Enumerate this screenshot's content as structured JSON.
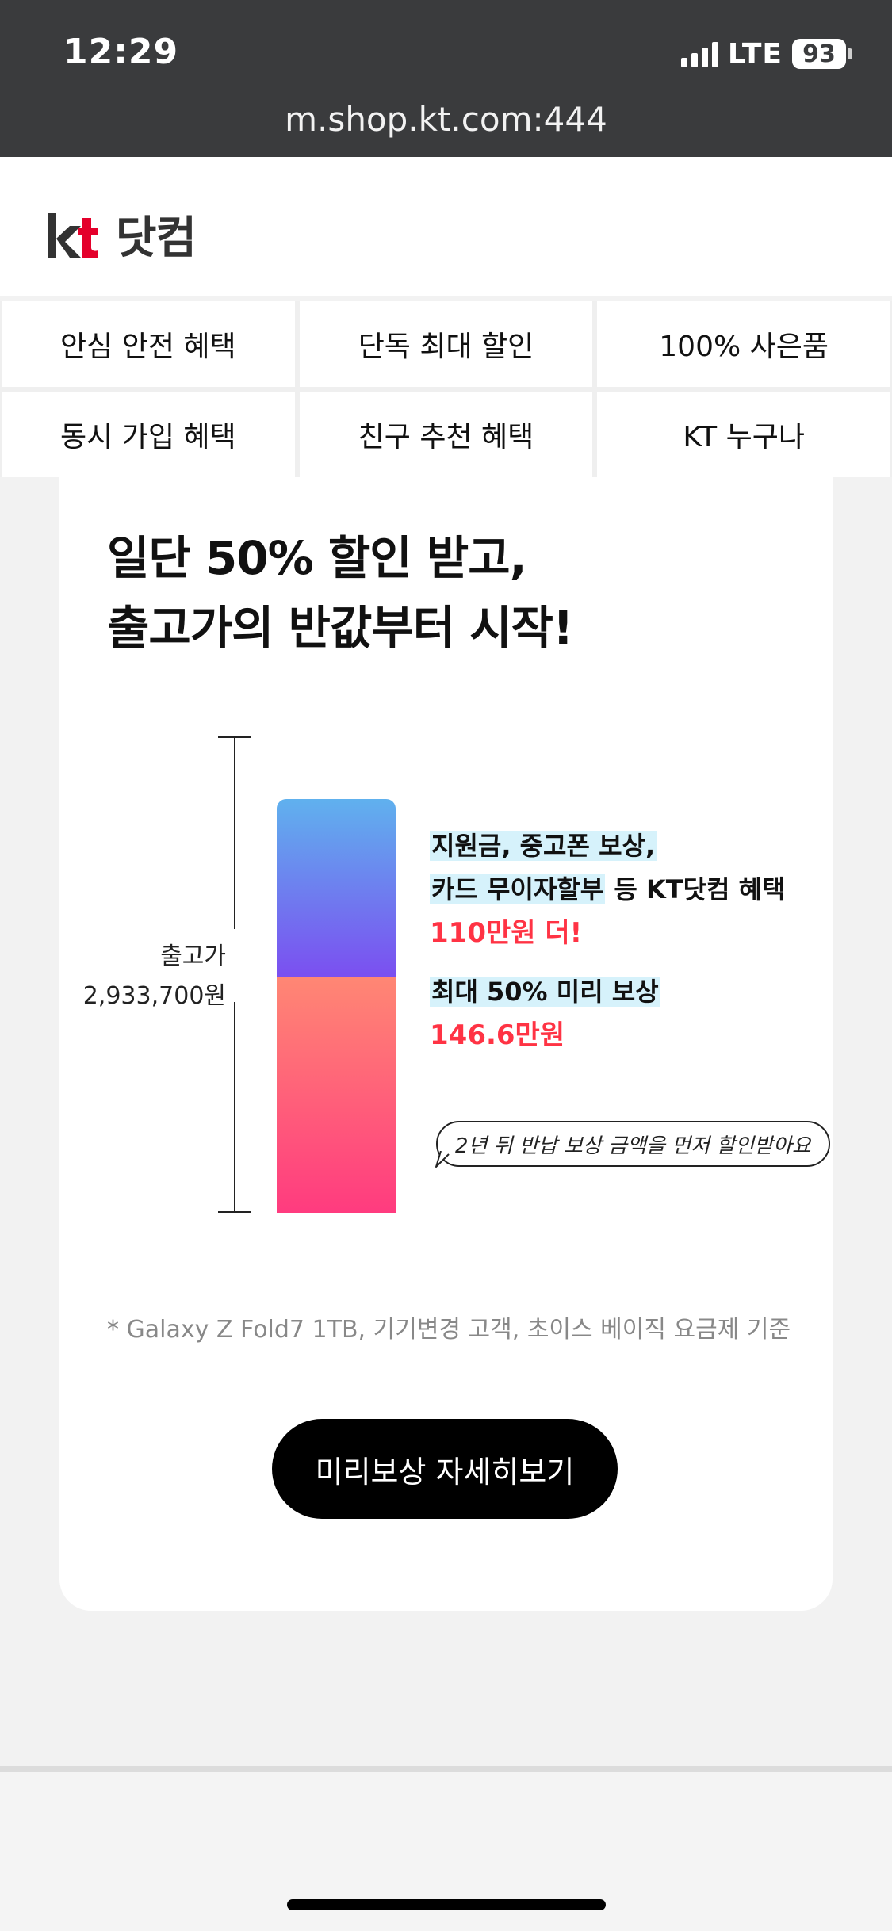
{
  "status": {
    "time": "12:29",
    "network": "LTE",
    "battery": "93"
  },
  "browser": {
    "url": "m.shop.kt.com:444"
  },
  "header": {
    "logo_mark": "kt",
    "logo_text": "닷컴"
  },
  "nav": [
    "안심 안전 혜택",
    "단독 최대 할인",
    "100% 사은품",
    "동시 가입 혜택",
    "친구 추천 혜택",
    "KT 누구나"
  ],
  "promo": {
    "headline_line1": "일단 50% 할인 받고,",
    "headline_line2": "출고가의 반값부터 시작!",
    "price_label": "출고가",
    "price_value": "2,933,700원",
    "upper_desc_line1": "지원금, 중고폰 보상,",
    "upper_desc_line2_hl": "카드 무이자할부",
    "upper_desc_line2_rest": " 등 KT닷컴 혜택",
    "upper_amount": "110만원 더!",
    "lower_desc": "최대 50% 미리 보상",
    "lower_amount": "146.6만원",
    "bubble": "2년 뒤 반납 보상 금액을 먼저 할인받아요",
    "footnote": "* Galaxy Z Fold7 1TB, 기기변경 고객, 초이스 베이직 요금제 기준",
    "cta": "미리보상 자세히보기"
  },
  "colors": {
    "status_bar": "#3a3b3d",
    "bar_top_start": "#60b1ee",
    "bar_top_end": "#7b4ff0",
    "bar_bottom_start": "#ff8774",
    "bar_bottom_end": "#ff3b7f",
    "accent_red": "#ff3344",
    "highlight": "#d6f2fb"
  }
}
